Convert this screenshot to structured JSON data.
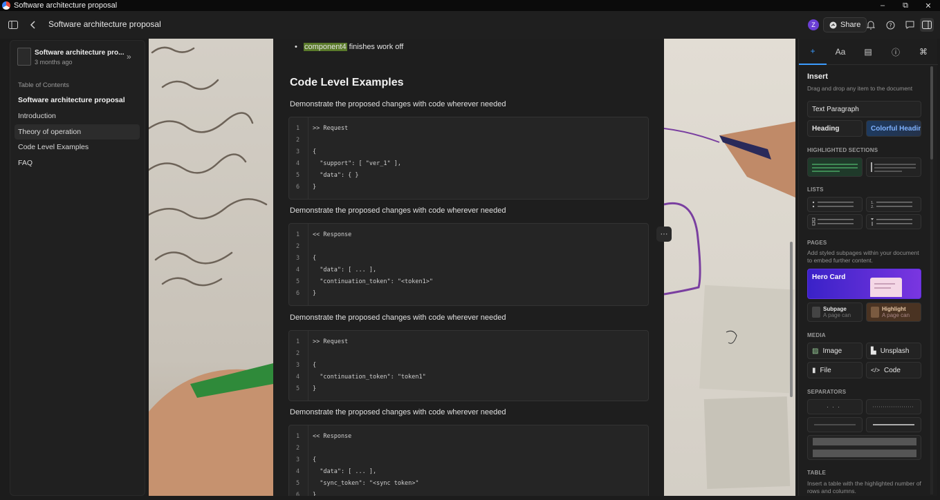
{
  "window": {
    "title": "Software architecture proposal",
    "controls": {
      "minimize": "–",
      "maximize": "⧉",
      "close": "✕"
    }
  },
  "topbar": {
    "doc_title": "Software architecture proposal",
    "avatar_initial": "Z",
    "share_label": "Share"
  },
  "sidebar": {
    "doc_title": "Software architecture pro...",
    "doc_meta": "3 months ago",
    "toc_header": "Table of Contents",
    "items": [
      {
        "label": "Software architecture proposal"
      },
      {
        "label": "Introduction"
      },
      {
        "label": "Theory of operation"
      },
      {
        "label": "Code Level Examples"
      },
      {
        "label": "FAQ"
      }
    ]
  },
  "doc": {
    "bullet": {
      "highlight": "component4",
      "rest": " finishes work off"
    },
    "heading": "Code Level Examples",
    "para": "Demonstrate the proposed changes with code wherever needed",
    "blocks": [
      {
        "lines": [
          ">> Request",
          "",
          "{",
          "  \"support\": [ \"ver_1\" ],",
          "  \"data\": { }",
          "}"
        ]
      },
      {
        "lines": [
          "<< Response",
          "",
          "{",
          "  \"data\": [ ... ],",
          "  \"continuation_token\": \"<token1>\"",
          "}"
        ]
      },
      {
        "lines": [
          ">> Request",
          "",
          "{",
          "  \"continuation_token\": \"token1\"",
          "}"
        ]
      },
      {
        "lines": [
          "<< Response",
          "",
          "{",
          "  \"data\": [ ... ],",
          "  \"sync_token\": \"<sync token>\"",
          "}"
        ]
      }
    ],
    "more": "···"
  },
  "panel": {
    "tabs": [
      "+",
      "Aa",
      "▤",
      "ⓘ",
      "⌘"
    ],
    "insert_title": "Insert",
    "insert_sub": "Drag and drop any item to the document",
    "text_paragraph": "Text Paragraph",
    "heading": "Heading",
    "colorful_heading": "Colorful Heading",
    "highlighted_sections": "HIGHLIGHTED SECTIONS",
    "lists": "LISTS",
    "pages": "PAGES",
    "pages_sub": "Add styled subpages within your document to embed further content.",
    "hero_card": "Hero Card",
    "subpage": "Subpage",
    "subpage_sub": "A page can",
    "highlight": "Highlight",
    "highlight_sub": "A page can",
    "media": "MEDIA",
    "image": "Image",
    "unsplash": "Unsplash",
    "file": "File",
    "code": "Code",
    "separators": "SEPARATORS",
    "table": "TABLE",
    "table_sub": "Insert a table with the highlighted number of rows and columns."
  },
  "colors": {
    "accent": "#3b9cff",
    "highlight": "#5a7a2a",
    "avatar": "#6b3fd4",
    "hero": "#5b2ee0"
  }
}
